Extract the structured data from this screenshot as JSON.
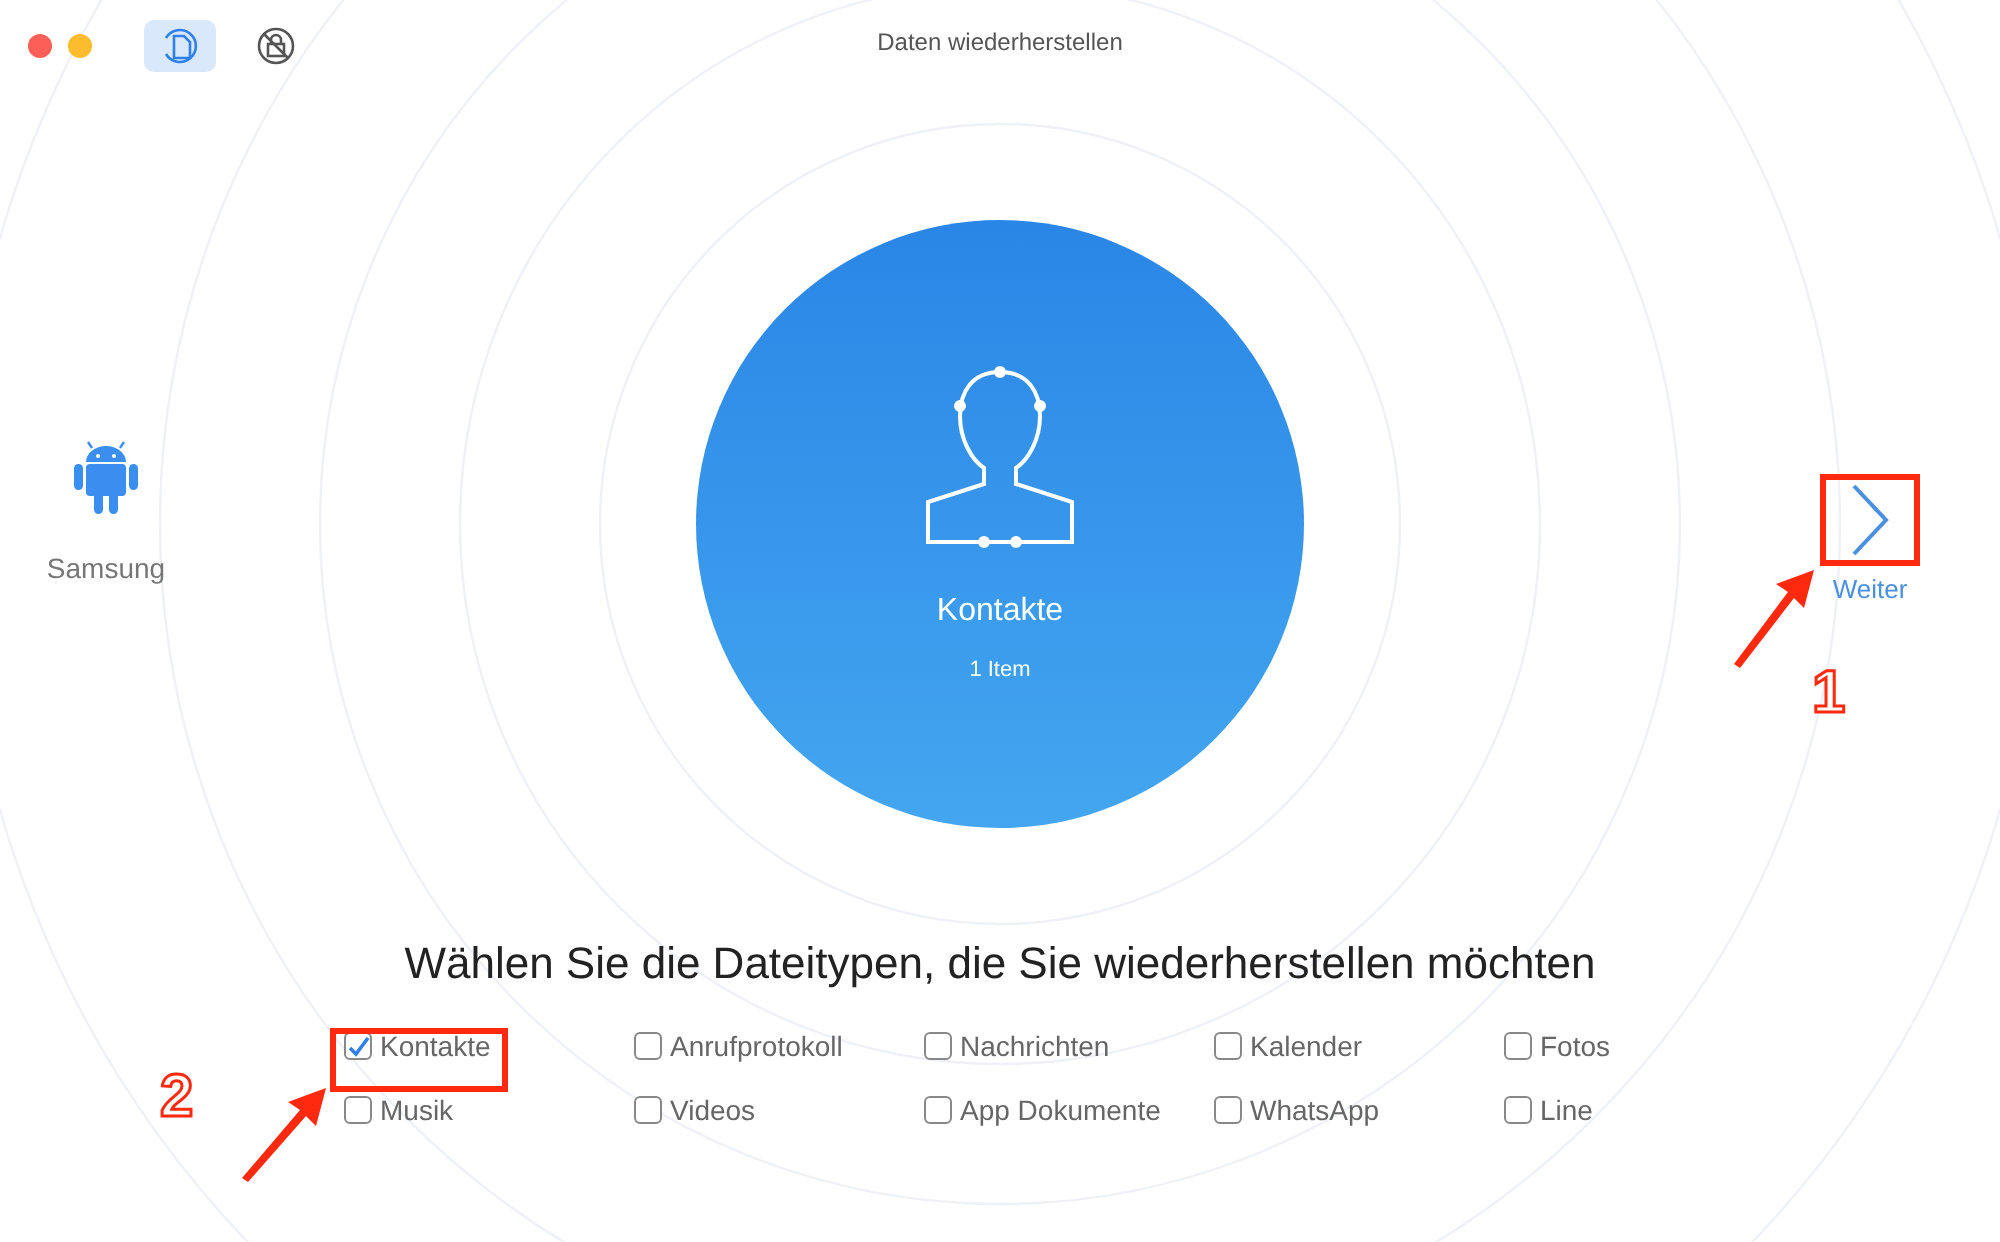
{
  "window": {
    "title": "Daten wiederherstellen",
    "toolbar": [
      {
        "kind": "restore",
        "selected": true
      },
      {
        "kind": "lock",
        "selected": false
      }
    ]
  },
  "device": {
    "name": "Samsung"
  },
  "category": {
    "name": "Kontakte",
    "count": "1 Item"
  },
  "next_button": {
    "label": "Weiter"
  },
  "heading": "Wählen Sie die Dateitypen, die Sie wiederherstellen möchten",
  "file_types": [
    {
      "label": "Kontakte",
      "checked": true
    },
    {
      "label": "Anrufprotokoll",
      "checked": false
    },
    {
      "label": "Nachrichten",
      "checked": false
    },
    {
      "label": "Kalender",
      "checked": false
    },
    {
      "label": "Fotos",
      "checked": false
    },
    {
      "label": "Musik",
      "checked": false
    },
    {
      "label": "Videos",
      "checked": false
    },
    {
      "label": "App Dokumente",
      "checked": false
    },
    {
      "label": "WhatsApp",
      "checked": false
    },
    {
      "label": "Line",
      "checked": false
    }
  ],
  "annotations": [
    {
      "number": "1"
    },
    {
      "number": "2"
    }
  ]
}
